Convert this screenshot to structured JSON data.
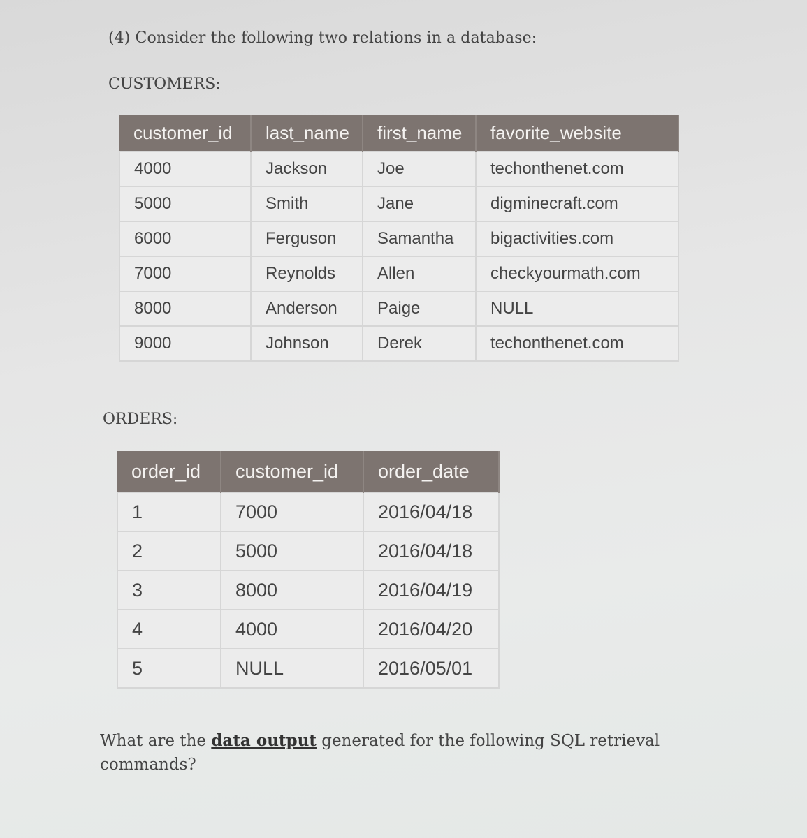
{
  "intro": "(4) Consider the following two relations in a database:",
  "customers": {
    "label": "CUSTOMERS:",
    "columns": [
      "customer_id",
      "last_name",
      "first_name",
      "favorite_website"
    ],
    "rows": [
      [
        "4000",
        "Jackson",
        "Joe",
        "techonthenet.com"
      ],
      [
        "5000",
        "Smith",
        "Jane",
        "digminecraft.com"
      ],
      [
        "6000",
        "Ferguson",
        "Samantha",
        "bigactivities.com"
      ],
      [
        "7000",
        "Reynolds",
        "Allen",
        "checkyourmath.com"
      ],
      [
        "8000",
        "Anderson",
        "Paige",
        "NULL"
      ],
      [
        "9000",
        "Johnson",
        "Derek",
        "techonthenet.com"
      ]
    ]
  },
  "orders": {
    "label": "ORDERS:",
    "columns": [
      "order_id",
      "customer_id",
      "order_date"
    ],
    "rows": [
      [
        "1",
        "7000",
        "2016/04/18"
      ],
      [
        "2",
        "5000",
        "2016/04/18"
      ],
      [
        "3",
        "8000",
        "2016/04/19"
      ],
      [
        "4",
        "4000",
        "2016/04/20"
      ],
      [
        "5",
        "NULL",
        "2016/05/01"
      ]
    ]
  },
  "question": {
    "prefix": "What are the ",
    "emphasis": "data output",
    "suffix": " generated for the following SQL retrieval commands?"
  }
}
